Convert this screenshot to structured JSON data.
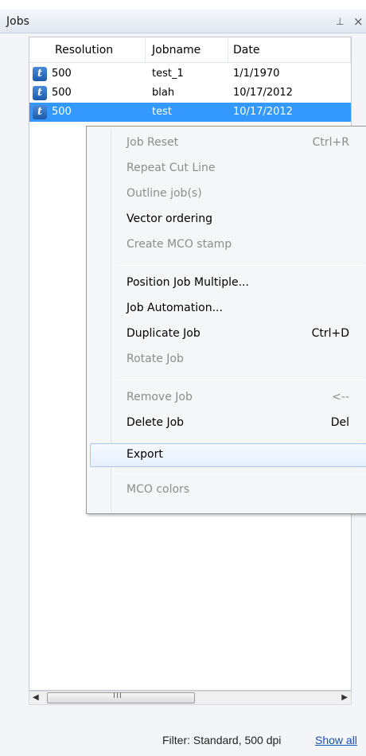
{
  "pane": {
    "title": "Jobs",
    "pin_glyph": "ᵖ",
    "close_glyph": "×"
  },
  "grid": {
    "columns": [
      "Resolution",
      "Jobname",
      "Date"
    ],
    "rows": [
      {
        "icon": "t",
        "resolution": "500",
        "jobname": "test_1",
        "date": "1/1/1970"
      },
      {
        "icon": "t",
        "resolution": "500",
        "jobname": "blah",
        "date": "10/17/2012"
      },
      {
        "icon": "t",
        "resolution": "500",
        "jobname": "test",
        "date": "10/17/2012",
        "selected": true
      }
    ]
  },
  "context_menu": {
    "items": [
      {
        "label": "Job Reset",
        "shortcut": "Ctrl+R",
        "enabled": false
      },
      {
        "label": "Repeat Cut Line",
        "shortcut": "",
        "enabled": false
      },
      {
        "label": "Outline job(s)",
        "shortcut": "",
        "enabled": false
      },
      {
        "label": "Vector ordering",
        "shortcut": "",
        "enabled": true
      },
      {
        "label": "Create MCO stamp",
        "shortcut": "",
        "enabled": false
      },
      {
        "label": "Position Job Multiple...",
        "shortcut": "",
        "enabled": true
      },
      {
        "label": "Job Automation...",
        "shortcut": "",
        "enabled": true
      },
      {
        "label": "Duplicate Job",
        "shortcut": "Ctrl+D",
        "enabled": true
      },
      {
        "label": "Rotate Job",
        "shortcut": "",
        "enabled": false
      },
      {
        "label": "Remove Job",
        "shortcut": "<--",
        "enabled": false
      },
      {
        "label": "Delete Job",
        "shortcut": "Del",
        "enabled": true
      },
      {
        "label": "Export",
        "shortcut": "",
        "enabled": true,
        "highlighted": true
      },
      {
        "label": "MCO colors",
        "shortcut": "",
        "enabled": false
      }
    ]
  },
  "scrollbar": {
    "grip": "III"
  },
  "status": {
    "filter": "Filter: Standard, 500 dpi",
    "show_all": "Show all"
  }
}
